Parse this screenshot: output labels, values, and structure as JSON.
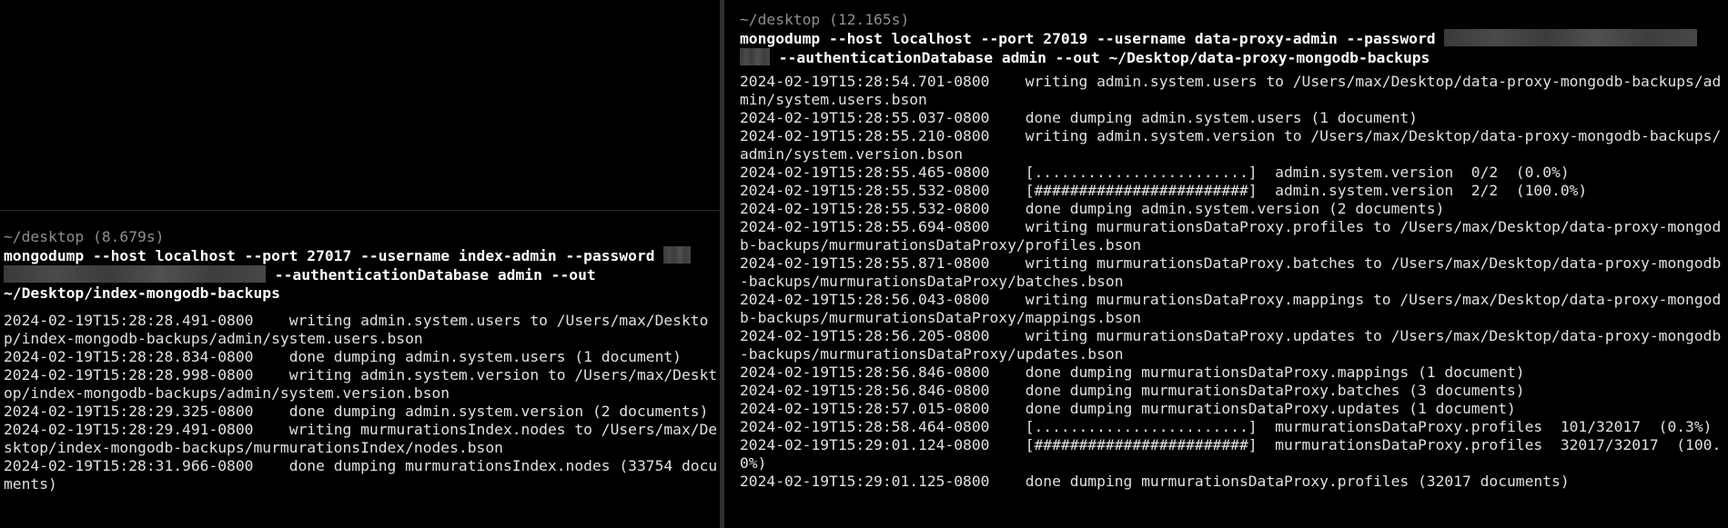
{
  "left_pane": {
    "prompt": "~/desktop (8.679s)",
    "command_part1": "mongodump --host localhost --port 27017 --username index-admin --password ",
    "command_part2": " --authenticationDatabase admin --out ~/Desktop/index-mongodb-backups",
    "log": [
      {
        "ts": "2024-02-19T15:28:28.491-0800",
        "msg": "writing admin.system.users to /Users/max/Desktop/index-mongodb-backups/admin/system.users.bson"
      },
      {
        "ts": "2024-02-19T15:28:28.834-0800",
        "msg": "done dumping admin.system.users (1 document)"
      },
      {
        "ts": "2024-02-19T15:28:28.998-0800",
        "msg": "writing admin.system.version to /Users/max/Desktop/index-mongodb-backups/admin/system.version.bson"
      },
      {
        "ts": "2024-02-19T15:28:29.325-0800",
        "msg": "done dumping admin.system.version (2 documents)"
      },
      {
        "ts": "2024-02-19T15:28:29.491-0800",
        "msg": "writing murmurationsIndex.nodes to /Users/max/Desktop/index-mongodb-backups/murmurationsIndex/nodes.bson"
      },
      {
        "ts": "2024-02-19T15:28:31.966-0800",
        "msg": "done dumping murmurationsIndex.nodes (33754 documents)"
      }
    ]
  },
  "right_pane": {
    "prompt": "~/desktop (12.165s)",
    "command_part1": "mongodump --host localhost --port 27019 --username data-proxy-admin --password ",
    "command_part2": " --authenticationDatabase admin --out ~/Desktop/data-proxy-mongodb-backups",
    "log": [
      {
        "ts": "2024-02-19T15:28:54.701-0800",
        "msg": "writing admin.system.users to /Users/max/Desktop/data-proxy-mongodb-backups/admin/system.users.bson"
      },
      {
        "ts": "2024-02-19T15:28:55.037-0800",
        "msg": "done dumping admin.system.users (1 document)"
      },
      {
        "ts": "2024-02-19T15:28:55.210-0800",
        "msg": "writing admin.system.version to /Users/max/Desktop/data-proxy-mongodb-backups/admin/system.version.bson"
      },
      {
        "ts": "2024-02-19T15:28:55.465-0800",
        "msg": "[........................]  admin.system.version  0/2  (0.0%)"
      },
      {
        "ts": "2024-02-19T15:28:55.532-0800",
        "msg": "[########################]  admin.system.version  2/2  (100.0%)"
      },
      {
        "ts": "2024-02-19T15:28:55.532-0800",
        "msg": "done dumping admin.system.version (2 documents)"
      },
      {
        "ts": "2024-02-19T15:28:55.694-0800",
        "msg": "writing murmurationsDataProxy.profiles to /Users/max/Desktop/data-proxy-mongodb-backups/murmurationsDataProxy/profiles.bson"
      },
      {
        "ts": "2024-02-19T15:28:55.871-0800",
        "msg": "writing murmurationsDataProxy.batches to /Users/max/Desktop/data-proxy-mongodb-backups/murmurationsDataProxy/batches.bson"
      },
      {
        "ts": "2024-02-19T15:28:56.043-0800",
        "msg": "writing murmurationsDataProxy.mappings to /Users/max/Desktop/data-proxy-mongodb-backups/murmurationsDataProxy/mappings.bson"
      },
      {
        "ts": "2024-02-19T15:28:56.205-0800",
        "msg": "writing murmurationsDataProxy.updates to /Users/max/Desktop/data-proxy-mongodb-backups/murmurationsDataProxy/updates.bson"
      },
      {
        "ts": "2024-02-19T15:28:56.846-0800",
        "msg": "done dumping murmurationsDataProxy.mappings (1 document)"
      },
      {
        "ts": "2024-02-19T15:28:56.846-0800",
        "msg": "done dumping murmurationsDataProxy.batches (3 documents)"
      },
      {
        "ts": "2024-02-19T15:28:57.015-0800",
        "msg": "done dumping murmurationsDataProxy.updates (1 document)"
      },
      {
        "ts": "2024-02-19T15:28:58.464-0800",
        "msg": "[........................]  murmurationsDataProxy.profiles  101/32017  (0.3%)"
      },
      {
        "ts": "2024-02-19T15:29:01.124-0800",
        "msg": "[########################]  murmurationsDataProxy.profiles  32017/32017  (100.0%)"
      },
      {
        "ts": "2024-02-19T15:29:01.125-0800",
        "msg": "done dumping murmurationsDataProxy.profiles (32017 documents)"
      }
    ]
  },
  "colors": {
    "background": "#000000",
    "prompt": "#8e8e8e",
    "command": "#ffffff",
    "output": "#e0e0e0",
    "divider": "#2e2e2e"
  }
}
